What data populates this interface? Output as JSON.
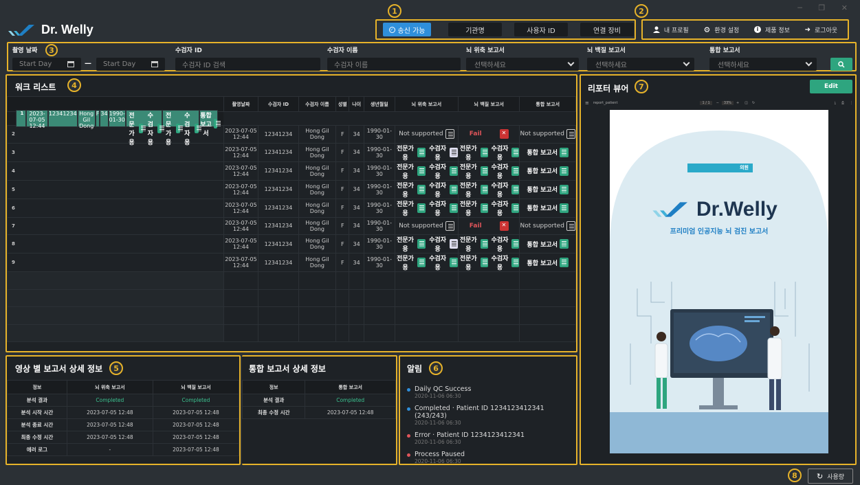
{
  "window": {
    "controls": "─ ❐ ✕"
  },
  "app": {
    "logo_text": "Dr. Welly"
  },
  "markers": [
    "1",
    "2",
    "3",
    "4",
    "5",
    "6",
    "7",
    "8"
  ],
  "status_tabs": [
    {
      "label": "송신 가능",
      "active": true
    },
    {
      "label": "기관명",
      "active": false
    },
    {
      "label": "사용자 ID",
      "active": false
    },
    {
      "label": "연결 장비",
      "active": false
    }
  ],
  "menu": [
    {
      "icon": "user-icon",
      "label": "내 프로필"
    },
    {
      "icon": "gear-icon",
      "label": "환경 설정"
    },
    {
      "icon": "info-icon",
      "label": "제품 정보"
    },
    {
      "icon": "logout-icon",
      "label": "로그아웃"
    }
  ],
  "filters": {
    "date_label": "촬영 날짜",
    "start_placeholder": "Start Day",
    "end_placeholder": "Start Day",
    "patient_id_label": "수검자 ID",
    "patient_id_placeholder": "수검자 ID 검색",
    "patient_name_label": "수검자 이름",
    "patient_name_placeholder": "수검자 이름",
    "atrophy_label": "뇌 위축 보고서",
    "atrophy_value": "선택하세요",
    "white_label": "뇌 백질 보고서",
    "white_value": "선택하세요",
    "integrated_label": "통합 보고서",
    "integrated_value": "선택하세요"
  },
  "worklist": {
    "title": "워크 리스트",
    "columns": [
      "",
      "촬영날짜",
      "수검자 ID",
      "수검자 이름",
      "성별",
      "나이",
      "생년월일",
      "뇌 위축 보고서",
      "뇌 백질 보고서",
      "통합 보고서"
    ],
    "labels": {
      "expert": "전문가용",
      "patient": "수검자용",
      "integrated": "통합 보고서",
      "not_supported": "Not supported",
      "fail": "Fail"
    },
    "rows": [
      {
        "n": "1",
        "date": "2023-07-05 12:44",
        "id": "12341234",
        "name": "Hong Gil Dong",
        "sex": "F",
        "age": "34",
        "dob": "1990-01-30",
        "atrophy": "ok",
        "white": "ok",
        "integ": "ok",
        "patient_doc": "normal"
      },
      {
        "n": "2",
        "date": "2023-07-05 12:44",
        "id": "12341234",
        "name": "Hong Gil Dong",
        "sex": "F",
        "age": "34",
        "dob": "1990-01-30",
        "atrophy": "ns",
        "white": "fail",
        "integ": "ns",
        "patient_doc": "normal"
      },
      {
        "n": "3",
        "date": "2023-07-05 12:44",
        "id": "12341234",
        "name": "Hong Gil Dong",
        "sex": "F",
        "age": "34",
        "dob": "1990-01-30",
        "atrophy": "ok",
        "white": "ok",
        "integ": "ok",
        "patient_doc": "white"
      },
      {
        "n": "4",
        "date": "2023-07-05 12:44",
        "id": "12341234",
        "name": "Hong Gil Dong",
        "sex": "F",
        "age": "34",
        "dob": "1990-01-30",
        "atrophy": "ok",
        "white": "ok",
        "integ": "ok",
        "patient_doc": "normal"
      },
      {
        "n": "5",
        "date": "2023-07-05 12:44",
        "id": "12341234",
        "name": "Hong Gil Dong",
        "sex": "F",
        "age": "34",
        "dob": "1990-01-30",
        "atrophy": "ok",
        "white": "ok",
        "integ": "ok",
        "patient_doc": "normal"
      },
      {
        "n": "6",
        "date": "2023-07-05 12:44",
        "id": "12341234",
        "name": "Hong Gil Dong",
        "sex": "F",
        "age": "34",
        "dob": "1990-01-30",
        "atrophy": "ok",
        "white": "ok",
        "integ": "ok",
        "patient_doc": "normal"
      },
      {
        "n": "7",
        "date": "2023-07-05 12:44",
        "id": "12341234",
        "name": "Hong Gil Dong",
        "sex": "F",
        "age": "34",
        "dob": "1990-01-30",
        "atrophy": "ns",
        "white": "fail",
        "integ": "ns",
        "patient_doc": "normal"
      },
      {
        "n": "8",
        "date": "2023-07-05 12:44",
        "id": "12341234",
        "name": "Hong Gil Dong",
        "sex": "F",
        "age": "34",
        "dob": "1990-01-30",
        "atrophy": "ok",
        "white": "ok",
        "integ": "ok",
        "patient_doc": "white"
      },
      {
        "n": "9",
        "date": "2023-07-05 12:44",
        "id": "12341234",
        "name": "Hong Gil Dong",
        "sex": "F",
        "age": "34",
        "dob": "1990-01-30",
        "atrophy": "ok",
        "white": "ok",
        "integ": "ok",
        "patient_doc": "normal"
      }
    ],
    "selected_row": 0
  },
  "image_detail": {
    "title": "영상 별 보고서 상세 정보",
    "headers": [
      "정보",
      "뇌 위축 보고서",
      "뇌 백질 보고서"
    ],
    "rows": [
      [
        "분석 결과",
        "Completed",
        "Completed"
      ],
      [
        "분석 시작 시간",
        "2023-07-05 12:48",
        "2023-07-05 12:48"
      ],
      [
        "분석 종료 시간",
        "2023-07-05 12:48",
        "2023-07-05 12:48"
      ],
      [
        "최종 수정 시간",
        "2023-07-05 12:48",
        "2023-07-05 12:48"
      ],
      [
        "에러 로그",
        "-",
        "2023-07-05 12:48"
      ]
    ]
  },
  "integrated_detail": {
    "title": "통합 보고서 상세 정보",
    "headers": [
      "정보",
      "통합 보고서"
    ],
    "rows": [
      [
        "분석 결과",
        "Completed"
      ],
      [
        "최종 수정 시간",
        "2023-07-05 12:48"
      ]
    ]
  },
  "alerts": {
    "title": "알림",
    "items": [
      {
        "text": "Daily QC Success",
        "date": "2020-11-06 06:30",
        "color": "#2f8fdb"
      },
      {
        "text": "Completed · Patient ID 1234123412341 (243/243)",
        "date": "2020-11-06 06:30",
        "color": "#2f8fdb"
      },
      {
        "text": "Error · Patient ID 1234123412341",
        "date": "2020-11-06 06:30",
        "color": "#e0555a"
      },
      {
        "text": "Process Paused",
        "date": "2020-11-06 06:30",
        "color": "#e0555a"
      }
    ]
  },
  "viewer": {
    "title": "리포터 뷰어",
    "edit_label": "Edit",
    "pdf_name": "report_patient",
    "pdf_page": "1 / 1",
    "pdf_zoom": "33%",
    "report_clinic": "의원",
    "report_logo": "Dr.Welly",
    "report_subtitle": "프리미엄 인공지능 뇌 검진 보고서"
  },
  "footer": {
    "usage_label": "사용량"
  },
  "colors": {
    "accent": "#2ea57f",
    "highlight": "#e7b32a",
    "active": "#2f8fdb",
    "error": "#e0555a"
  }
}
